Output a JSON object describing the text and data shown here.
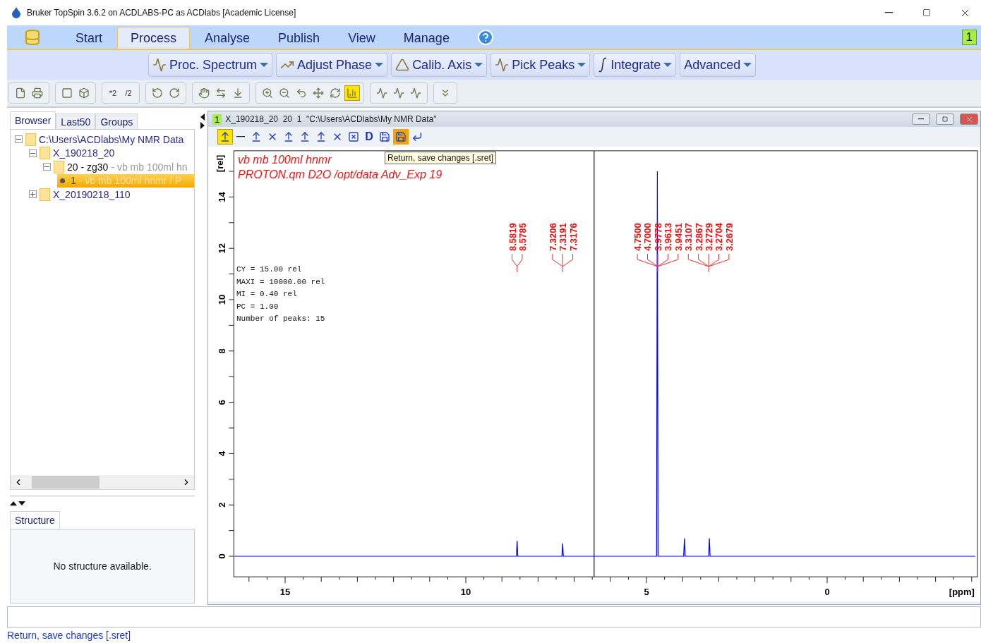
{
  "window": {
    "title": "Bruker TopSpin 3.6.2 on ACDLABS-PC as ACDlabs [Academic License]"
  },
  "menu_tabs": [
    {
      "label": "Start",
      "selected": false
    },
    {
      "label": "Process",
      "selected": true
    },
    {
      "label": "Analyse",
      "selected": false
    },
    {
      "label": "Publish",
      "selected": false
    },
    {
      "label": "View",
      "selected": false
    },
    {
      "label": "Manage",
      "selected": false
    }
  ],
  "window_number": "1",
  "ribbon": [
    {
      "label": "Proc. Spectrum",
      "kind": "peak"
    },
    {
      "label": "Adjust Phase",
      "kind": "phase"
    },
    {
      "label": "Calib. Axis",
      "kind": "calib"
    },
    {
      "label": "Pick Peaks",
      "kind": "pick"
    },
    {
      "label": "Integrate",
      "kind": "integral"
    },
    {
      "label": "Advanced",
      "kind": "none"
    }
  ],
  "toolbar": [
    [
      {
        "kind": "file",
        "selected": false
      },
      {
        "kind": "printer",
        "selected": false
      }
    ],
    [
      {
        "kind": "square",
        "selected": false
      },
      {
        "kind": "cube",
        "selected": false
      }
    ],
    [
      {
        "kind": "text",
        "label": "*2",
        "selected": false
      },
      {
        "kind": "text",
        "label": "/2",
        "selected": false
      }
    ],
    [
      {
        "kind": "rotate-left",
        "selected": false
      },
      {
        "kind": "rotate-right",
        "selected": false
      }
    ],
    [
      {
        "kind": "hand",
        "selected": false
      },
      {
        "kind": "swap",
        "selected": false
      },
      {
        "kind": "baseline",
        "selected": false
      }
    ],
    [
      {
        "kind": "zoom-in",
        "selected": false
      },
      {
        "kind": "zoom-out",
        "selected": false
      },
      {
        "kind": "undo",
        "selected": false
      },
      {
        "kind": "move",
        "selected": false
      },
      {
        "kind": "refresh",
        "selected": false
      },
      {
        "kind": "chart",
        "selected": true
      }
    ],
    [
      {
        "kind": "peaks",
        "selected": false
      },
      {
        "kind": "peaks",
        "selected": false
      },
      {
        "kind": "peaks",
        "selected": false
      }
    ],
    [
      {
        "kind": "chevrons",
        "selected": false
      }
    ]
  ],
  "browser": {
    "tabs": [
      {
        "label": "Browser",
        "selected": true
      },
      {
        "label": "Last50",
        "selected": false
      },
      {
        "label": "Groups",
        "selected": false
      }
    ],
    "tree": [
      {
        "kind": "folder",
        "name": "C:\\Users\\ACDlabs\\My NMR Data",
        "expanded": true,
        "selected": false,
        "children": [
          {
            "kind": "folder",
            "name": "X_190218_20",
            "expanded": true,
            "selected": false,
            "children": [
              {
                "kind": "folder",
                "name": "20 - zg30",
                "detail": "- vb mb 100ml hn",
                "expanded": true,
                "selected": false,
                "children": [
                  {
                    "kind": "procno",
                    "name": "1",
                    "detail": "- vb mb 100ml hnmr / P",
                    "selected": true
                  }
                ]
              }
            ]
          },
          {
            "kind": "folder",
            "name": "X_20190218_110",
            "expanded": false,
            "selected": false
          }
        ]
      }
    ]
  },
  "structure": {
    "tab": "Structure",
    "message": "No structure available."
  },
  "spectrum_window": {
    "number": "1",
    "title": "X_190218_20  20  1  \"C:\\Users\\ACDlabs\\My NMR Data\"",
    "tools": [
      {
        "kind": "arrow-up",
        "selected": true,
        "hovered": false
      },
      {
        "kind": "minus",
        "selected": false,
        "hovered": false
      },
      {
        "kind": "arrow-up",
        "selected": false,
        "hovered": false
      },
      {
        "kind": "cross",
        "selected": false,
        "hovered": false
      },
      {
        "kind": "arrow-up",
        "selected": false,
        "hovered": false
      },
      {
        "kind": "arrow-up",
        "selected": false,
        "hovered": false
      },
      {
        "kind": "arrow-up",
        "selected": false,
        "hovered": false
      },
      {
        "kind": "cross",
        "selected": false,
        "hovered": false
      },
      {
        "kind": "box-cross",
        "selected": false,
        "hovered": false
      },
      {
        "kind": "text",
        "label": "D",
        "selected": false,
        "hovered": false
      },
      {
        "kind": "save",
        "selected": false,
        "hovered": false
      },
      {
        "kind": "save",
        "selected": false,
        "hovered": true
      },
      {
        "kind": "return",
        "selected": false,
        "hovered": false
      }
    ],
    "tooltip": "Return, save changes [.sret]",
    "title_lines": [
      "vb mb 100ml hnmr",
      "PROTON.qm D2O /opt/data Adv_Exp 19"
    ],
    "parameters": [
      "CY = 15.00 rel",
      "MAXI = 10000.00 rel",
      "MI = 0.40 rel",
      "PC = 1.00",
      "Number of peaks: 15"
    ],
    "chart_data": {
      "type": "line",
      "xlabel": "[ppm]",
      "ylabel": "[rel]",
      "xlim": [
        16.4,
        -4.1
      ],
      "ylim": [
        -0.8,
        15.8
      ],
      "xticks": [
        15,
        10,
        5,
        0
      ],
      "yticks": [
        0,
        2,
        4,
        6,
        8,
        10,
        12,
        14
      ],
      "x": [
        16.4,
        8.6,
        8.58,
        8.56,
        7.34,
        7.32,
        7.3,
        4.72,
        4.7,
        4.68,
        3.97,
        3.95,
        3.93,
        3.28,
        3.26,
        3.24,
        -4.1
      ],
      "ref_lines": [
        {
          "axis": "x",
          "value": 6.45,
          "color": "#444444"
        }
      ],
      "series": [
        {
          "color": "#0000ff",
          "values": [
            0,
            0,
            0.6,
            0,
            0,
            0.5,
            0,
            0,
            15,
            0,
            0,
            0.7,
            0,
            0,
            0.7,
            0,
            0
          ]
        }
      ]
    },
    "peak_groups": [
      {
        "labels": [
          "8.5819",
          "8.5785"
        ]
      },
      {
        "labels": [
          "7.3206",
          "7.3191",
          "7.3176"
        ]
      },
      {
        "labels": [
          "4.7500",
          "4.7000",
          "3.9778",
          "3.9613",
          "3.9451"
        ]
      },
      {
        "labels": [
          "3.3107",
          "3.2867",
          "3.2729",
          "3.2704",
          "3.2679"
        ]
      }
    ]
  },
  "status_bar": "Return, save changes [.sret]"
}
